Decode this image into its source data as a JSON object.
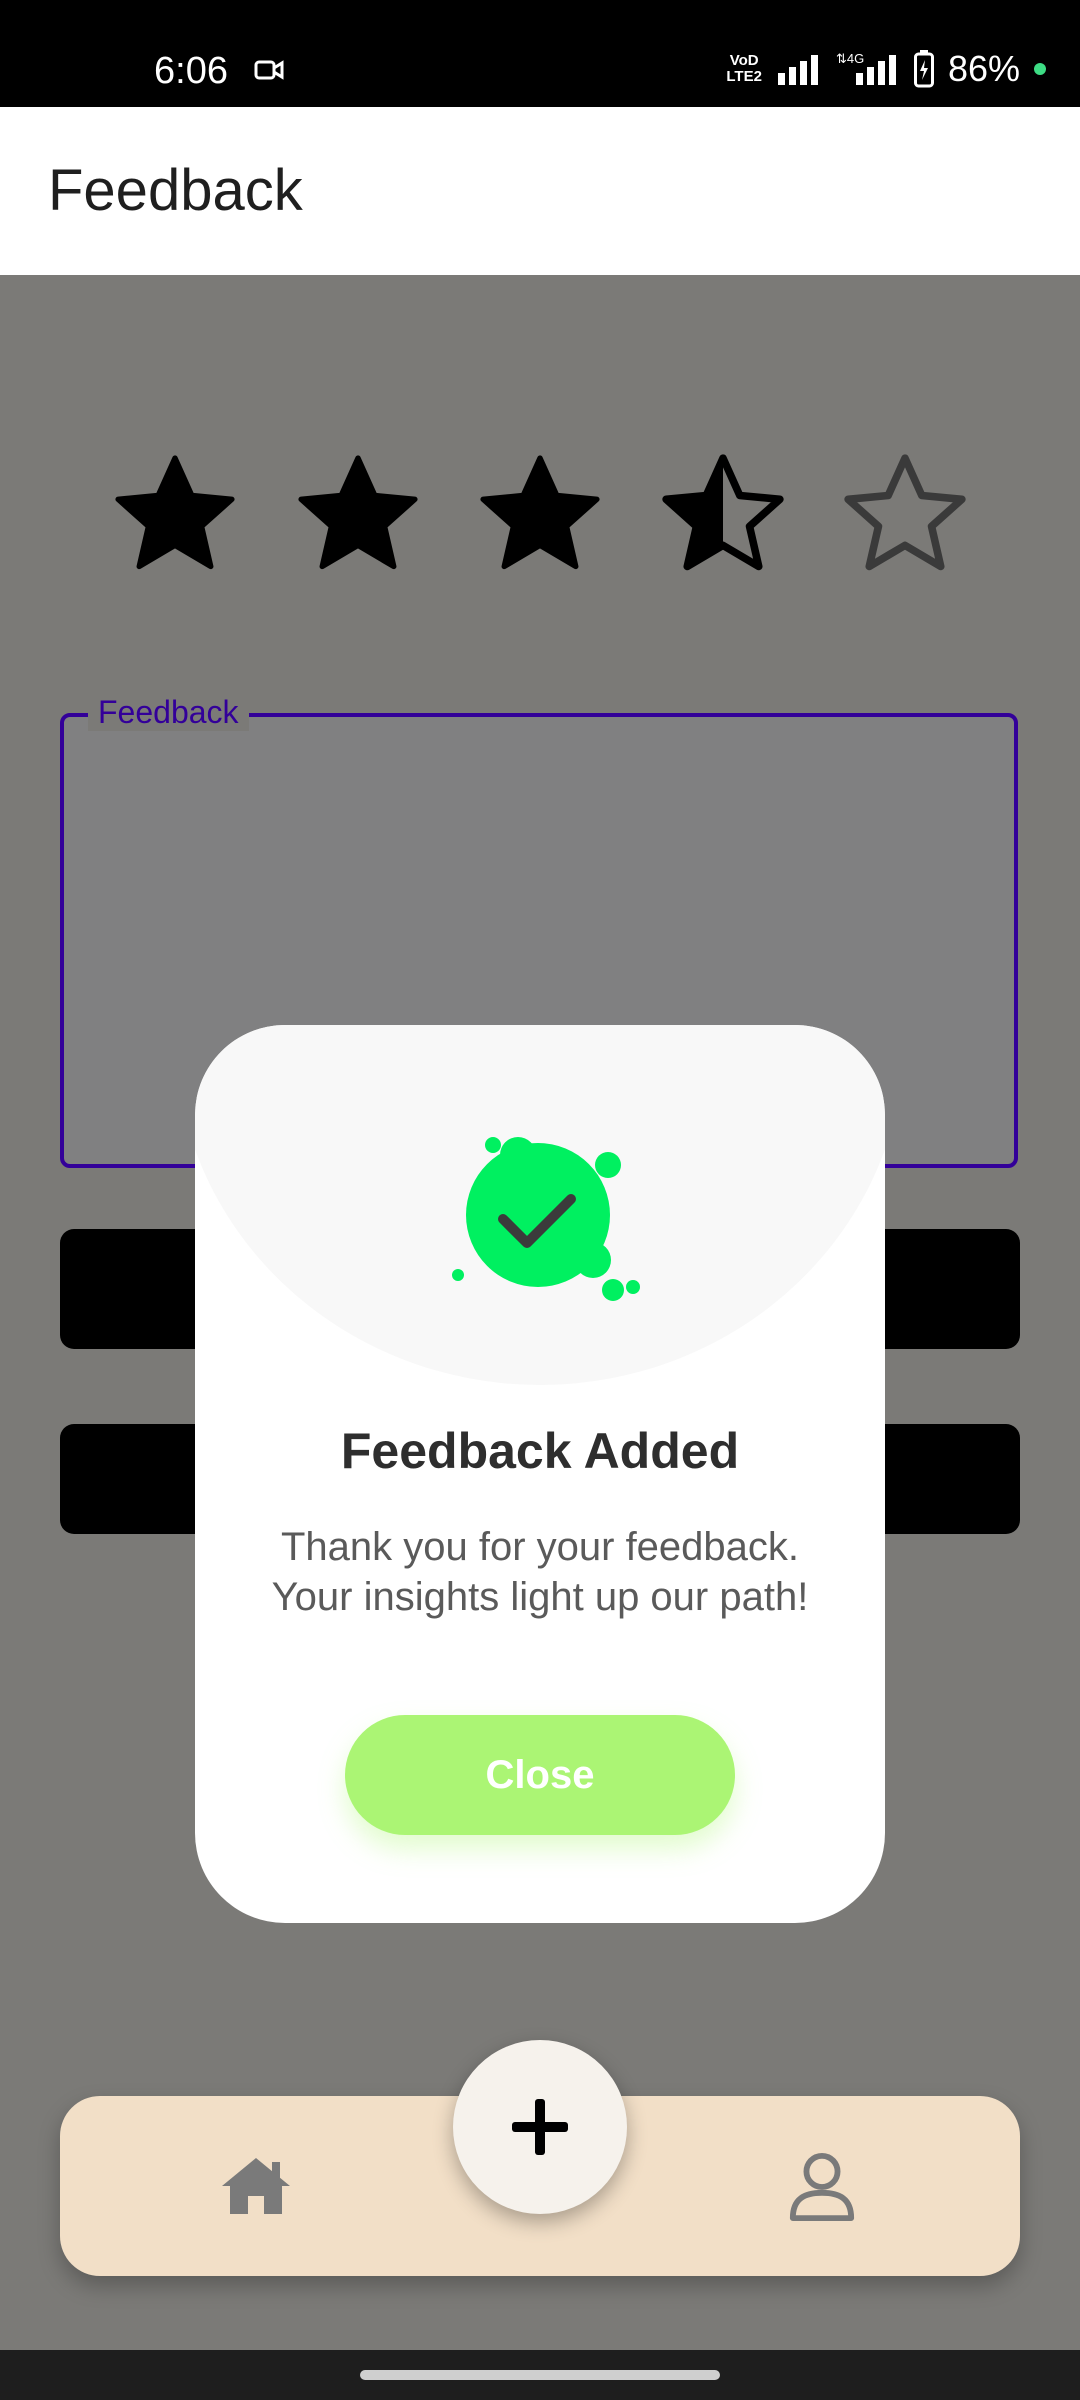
{
  "status_bar": {
    "time": "6:06",
    "battery": "86%",
    "volte": "VoLTE2",
    "network": "4G"
  },
  "app_bar": {
    "title": "Feedback"
  },
  "rating": {
    "value": 3.5,
    "max": 5
  },
  "feedback_field": {
    "label": "Feedback",
    "value": ""
  },
  "dialog": {
    "title": "Feedback Added",
    "message_line1": "Thank you for your feedback.",
    "message_line2": "Your insights light up our path!",
    "close_label": "Close"
  },
  "bottom_nav": {
    "items": [
      {
        "icon": "home-icon"
      },
      {
        "icon": "add-icon"
      },
      {
        "icon": "profile-icon"
      }
    ]
  },
  "colors": {
    "accent": "#330099",
    "success": "#00f060",
    "close_button": "#abf574",
    "nav_background": "#f2dfc7"
  }
}
